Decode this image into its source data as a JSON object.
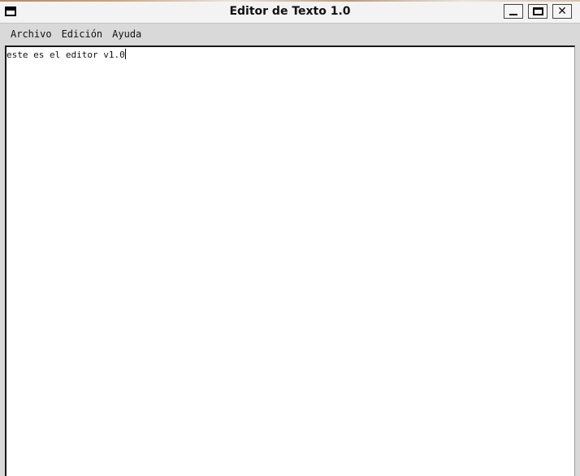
{
  "window": {
    "title": "Editor de Texto 1.0",
    "icon": "window-icon",
    "controls": {
      "minimize": "minimize-icon",
      "maximize": "maximize-icon",
      "close": "close-icon",
      "close_glyph": "✕"
    }
  },
  "menubar": {
    "items": [
      {
        "label": "Archivo"
      },
      {
        "label": "Edición"
      },
      {
        "label": "Ayuda"
      }
    ]
  },
  "editor": {
    "content": "este es el editor v1.0"
  },
  "colors": {
    "window_bg": "#d9d9d9",
    "titlebar_bg": "#f3f3f3",
    "editor_bg": "#ffffff",
    "text": "#111111"
  }
}
